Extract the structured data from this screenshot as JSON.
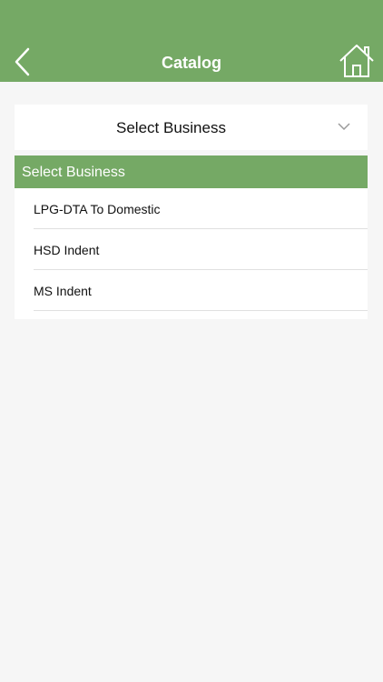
{
  "header": {
    "title": "Catalog",
    "back_icon": "chevron-left-icon",
    "home_icon": "home-icon",
    "background_color": "#75a965"
  },
  "select": {
    "label": "Select Business",
    "icon": "chevron-down-icon"
  },
  "dropdown": {
    "header": "Select Business",
    "items": [
      {
        "label": "LPG-DTA To Domestic"
      },
      {
        "label": "HSD Indent"
      },
      {
        "label": "MS Indent"
      }
    ]
  }
}
